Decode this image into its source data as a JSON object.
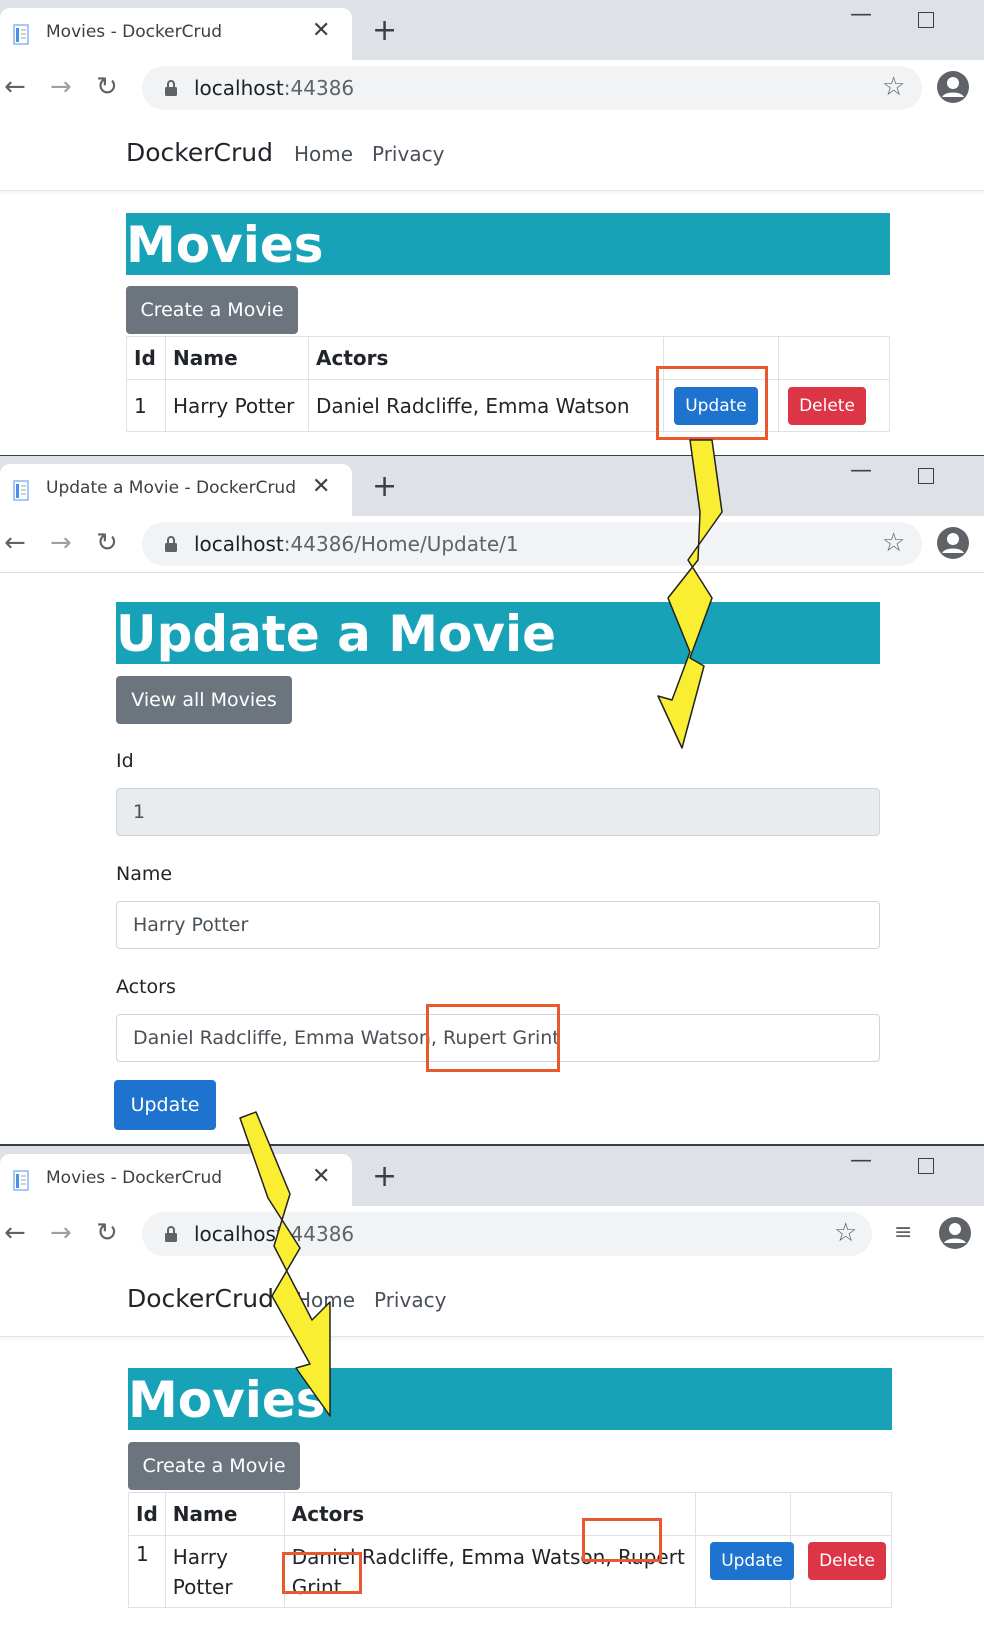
{
  "shot1": {
    "tab_title": "Movies - DockerCrud",
    "url_host": "localhost",
    "url_port": ":44386",
    "url_path": "",
    "brand": "DockerCrud",
    "nav": [
      "Home",
      "Privacy"
    ],
    "heading": "Movies",
    "create_label": "Create a Movie",
    "columns": [
      "Id",
      "Name",
      "Actors"
    ],
    "row": {
      "id": "1",
      "name": "Harry Potter",
      "actors": "Daniel Radcliffe, Emma Watson"
    },
    "update_label": "Update",
    "delete_label": "Delete"
  },
  "shot2": {
    "tab_title": "Update a Movie - DockerCrud",
    "url_host": "localhost",
    "url_port": ":44386",
    "url_path": "/Home/Update/1",
    "heading": "Update a Movie",
    "view_all_label": "View all Movies",
    "fields": {
      "id_label": "Id",
      "id_value": "1",
      "name_label": "Name",
      "name_value": "Harry Potter",
      "actors_label": "Actors",
      "actors_value": "Daniel Radcliffe, Emma Watson, Rupert Grint"
    },
    "submit_label": "Update"
  },
  "shot3": {
    "tab_title": "Movies - DockerCrud",
    "url_host": "localhos",
    "url_port": "t:44386",
    "url_path": "",
    "brand": "DockerCrud",
    "nav": [
      "Home",
      "Privacy"
    ],
    "heading": "Movies",
    "create_label": "Create a Movie",
    "columns": [
      "Id",
      "Name",
      "Actors"
    ],
    "row": {
      "id": "1",
      "name_line1": "Harry",
      "name_line2": "Potter",
      "actors_line1": "Daniel Radcliffe, Emma Watson, Rupert",
      "actors_line2": "Grint"
    },
    "update_label": "Update",
    "delete_label": "Delete"
  },
  "colors": {
    "accent": "#17a2b8",
    "primary": "#1e73cf",
    "danger": "#dc3545",
    "secondary": "#6c757d",
    "highlight": "#e8592e",
    "arrow": "#f9ee31"
  }
}
